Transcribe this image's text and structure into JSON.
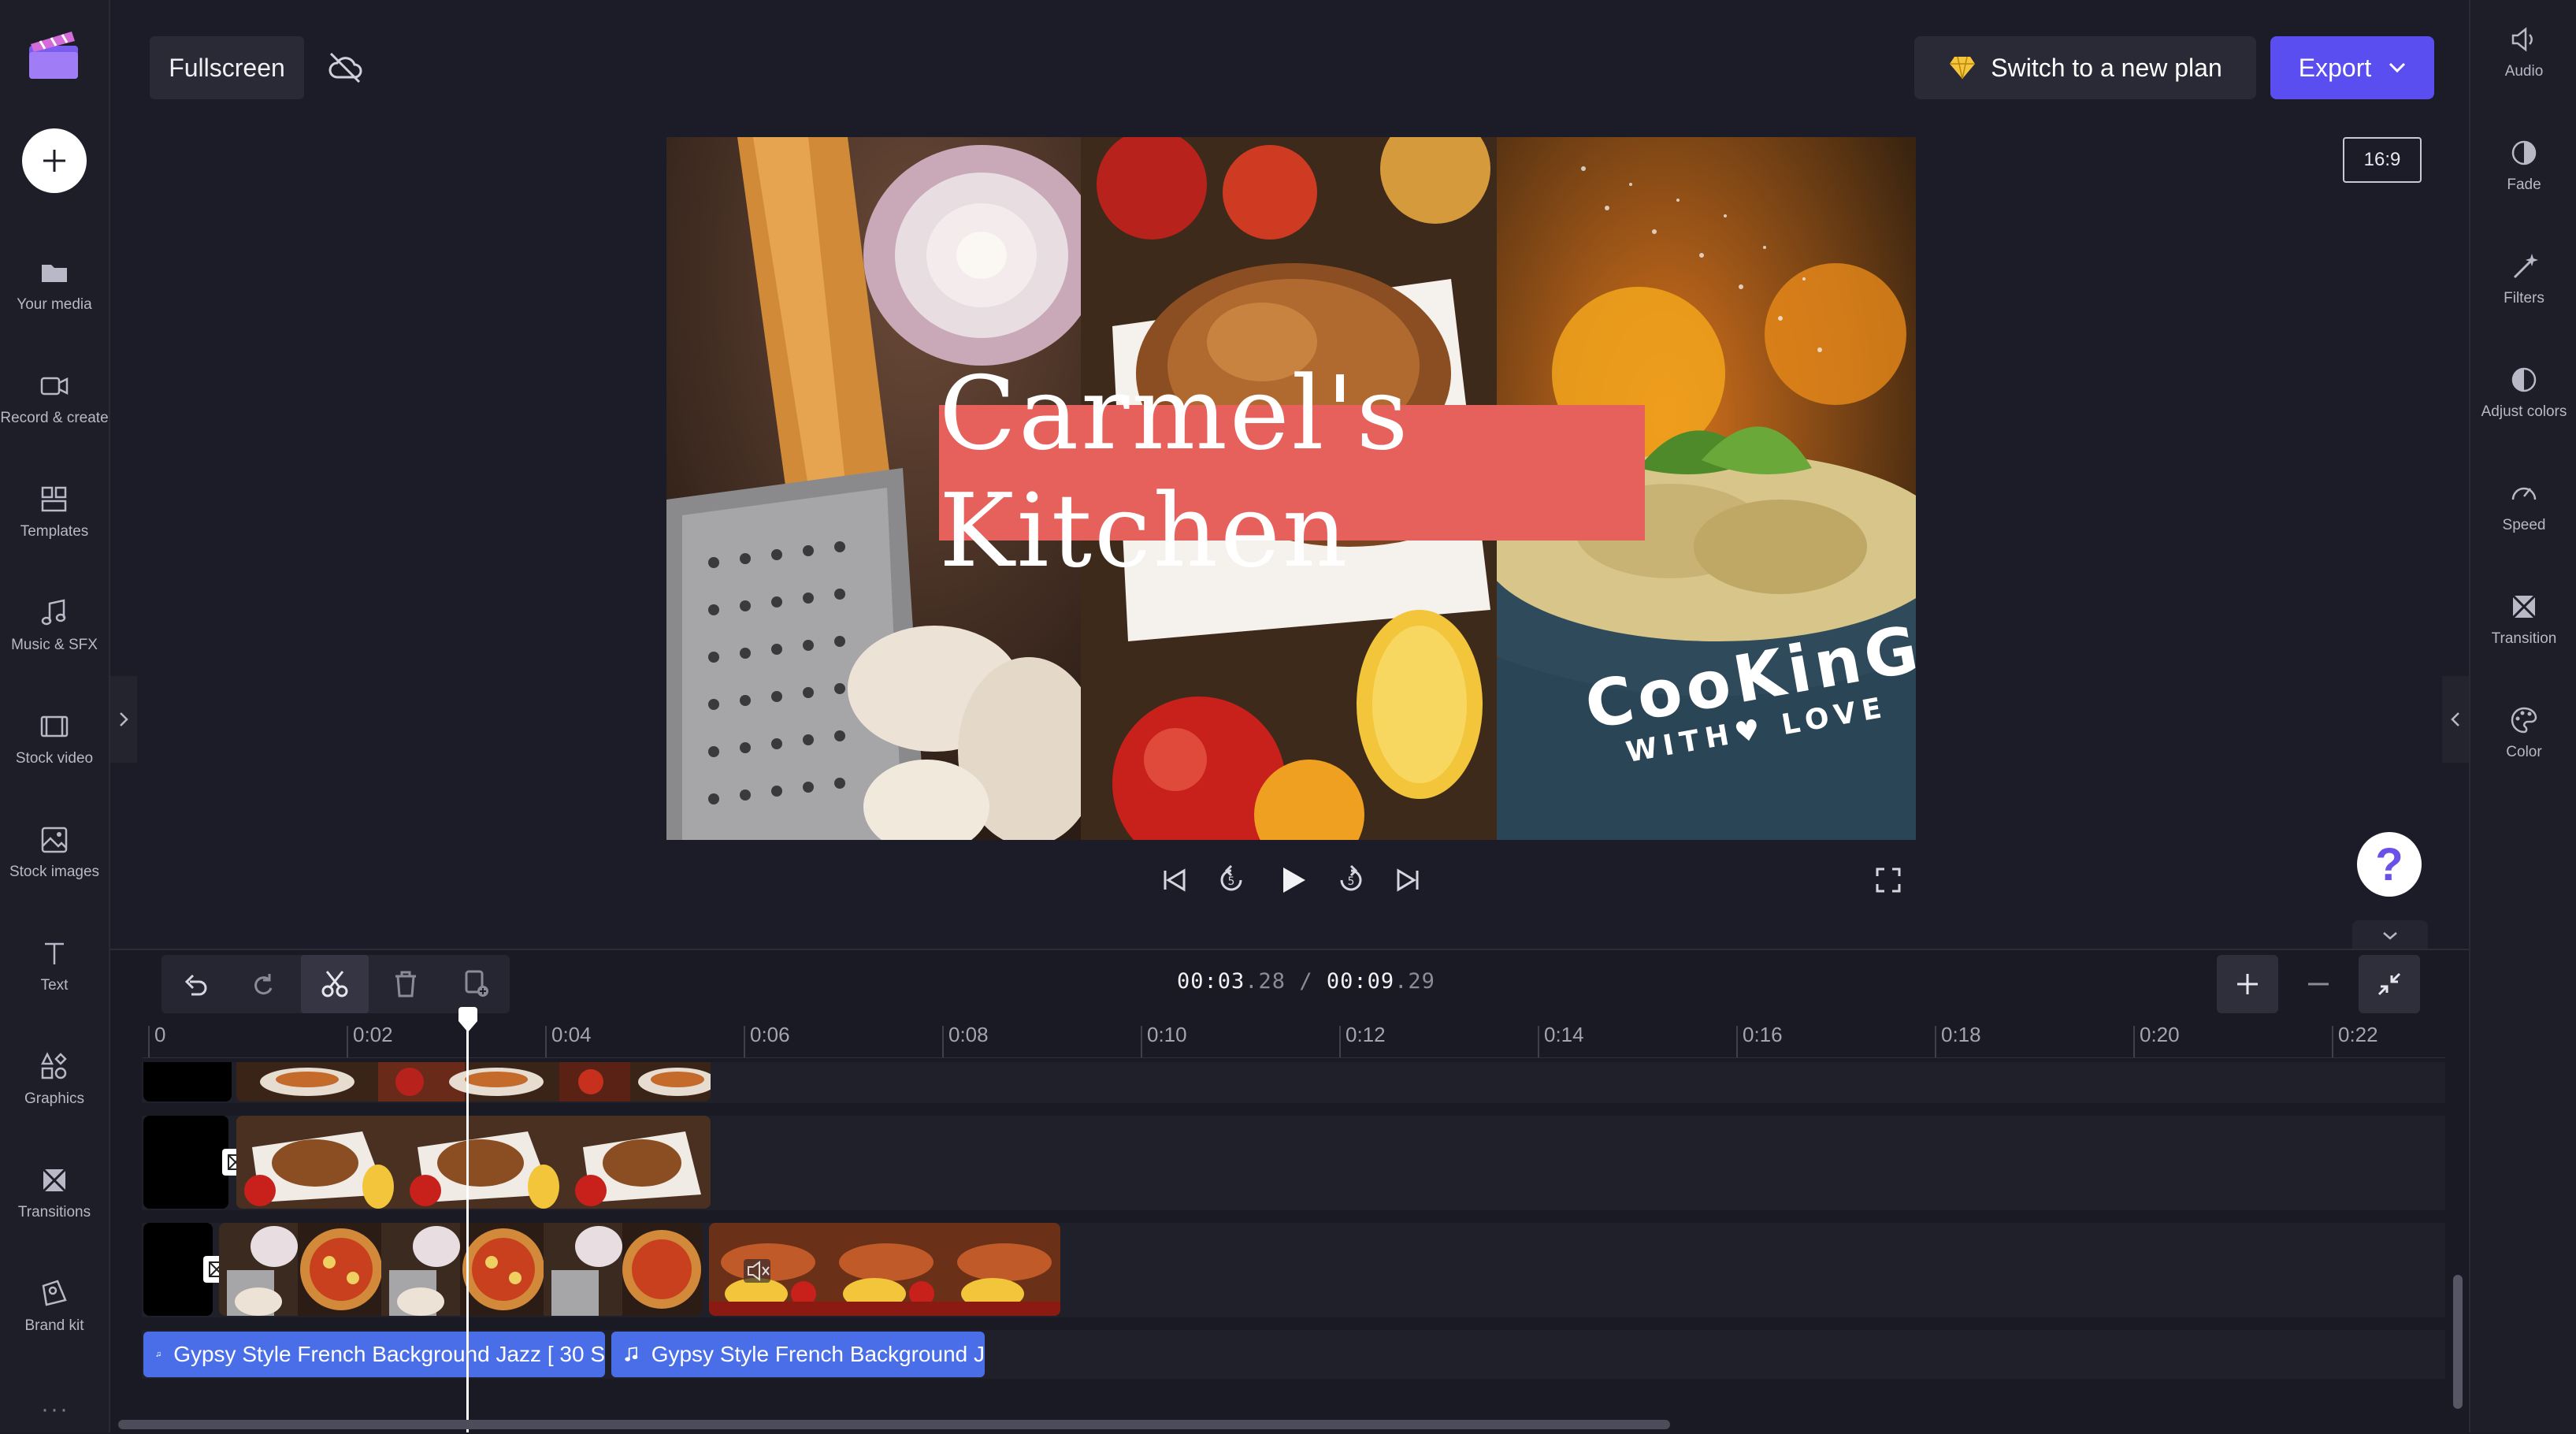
{
  "topbar": {
    "fullscreen_label": "Fullscreen",
    "plan_label": "Switch to a new plan",
    "export_label": "Export",
    "aspect_ratio": "16:9"
  },
  "left_nav": [
    {
      "id": "your-media",
      "label": "Your media",
      "icon": "folder-icon"
    },
    {
      "id": "record-create",
      "label": "Record & create",
      "icon": "camera-icon"
    },
    {
      "id": "templates",
      "label": "Templates",
      "icon": "templates-icon"
    },
    {
      "id": "music-sfx",
      "label": "Music & SFX",
      "icon": "music-icon"
    },
    {
      "id": "stock-video",
      "label": "Stock video",
      "icon": "film-icon"
    },
    {
      "id": "stock-images",
      "label": "Stock images",
      "icon": "image-icon"
    },
    {
      "id": "text",
      "label": "Text",
      "icon": "text-icon"
    },
    {
      "id": "graphics",
      "label": "Graphics",
      "icon": "shapes-icon"
    },
    {
      "id": "transitions",
      "label": "Transitions",
      "icon": "transition-icon"
    },
    {
      "id": "brand-kit",
      "label": "Brand kit",
      "icon": "brand-icon"
    }
  ],
  "right_nav": [
    {
      "id": "audio",
      "label": "Audio",
      "icon": "speaker-icon"
    },
    {
      "id": "fade",
      "label": "Fade",
      "icon": "fade-icon"
    },
    {
      "id": "filters",
      "label": "Filters",
      "icon": "wand-icon"
    },
    {
      "id": "adjust-colors",
      "label": "Adjust colors",
      "icon": "contrast-icon"
    },
    {
      "id": "speed",
      "label": "Speed",
      "icon": "speedometer-icon"
    },
    {
      "id": "transition",
      "label": "Transition",
      "icon": "transition-icon"
    },
    {
      "id": "color",
      "label": "Color",
      "icon": "palette-icon"
    }
  ],
  "preview": {
    "title_text": "Carmel's Kitchen",
    "overlay_line1": "CooKinG",
    "overlay_line2": "WITH♥ LOVE"
  },
  "help_label": "?",
  "timeline": {
    "current_time": "00:03",
    "current_frames": ".28",
    "separator": "/",
    "total_time": "00:09",
    "total_frames": ".29",
    "ruler_labels": [
      "0",
      "0:02",
      "0:04",
      "0:06",
      "0:08",
      "0:10",
      "0:12",
      "0:14",
      "0:16",
      "0:18",
      "0:20",
      "0:22"
    ],
    "audio_clips": [
      {
        "label": "Gypsy Style French Background Jazz [ 30 S"
      },
      {
        "label": "Gypsy Style French Background J"
      }
    ]
  },
  "colors": {
    "accent": "#5b4ef0",
    "title_bg": "#e6615b",
    "audio_clip": "#4a6ee8",
    "background": "#1c1c28"
  }
}
